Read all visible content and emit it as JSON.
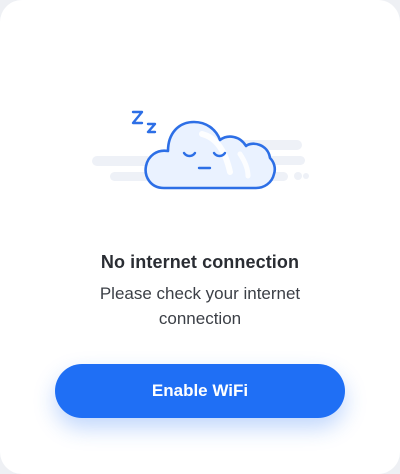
{
  "illustration": {
    "icon": "sleeping-cloud-icon",
    "sleep_letters": [
      "Z",
      "z"
    ]
  },
  "message": {
    "title": "No internet connection",
    "subtitle": "Please check your internet connection"
  },
  "action": {
    "label": "Enable WiFi"
  },
  "colors": {
    "accent": "#1f6ff5",
    "cloud_outline": "#2d6fe6",
    "cloud_fill": "#eaf2ff",
    "background_streaks": "#eef1f7"
  }
}
